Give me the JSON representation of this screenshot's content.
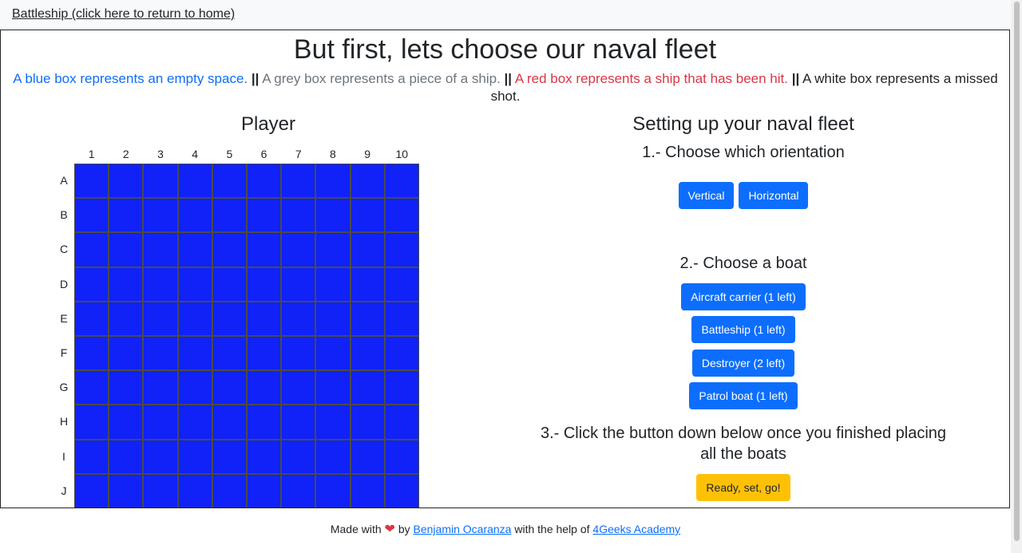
{
  "nav": {
    "home_link": "Battleship (click here to return to home)"
  },
  "main": {
    "title": "But first, lets choose our naval fleet",
    "legend": {
      "blue": "A blue box represents an empty space.",
      "grey": "A grey box represents a piece of a ship.",
      "red": "A red box represents a ship that has been hit.",
      "white": "A white box represents a missed shot.",
      "separator": "||"
    }
  },
  "board": {
    "title": "Player",
    "columns": [
      "1",
      "2",
      "3",
      "4",
      "5",
      "6",
      "7",
      "8",
      "9",
      "10"
    ],
    "rows": [
      "A",
      "B",
      "C",
      "D",
      "E",
      "F",
      "G",
      "H",
      "I",
      "J"
    ],
    "empty_color": "#1022f7"
  },
  "setup": {
    "title": "Setting up your naval fleet",
    "step1": "1.- Choose which orientation",
    "orientation_buttons": [
      "Vertical",
      "Horizontal"
    ],
    "step2": "2.- Choose a boat",
    "boat_buttons": [
      "Aircraft carrier (1 left)",
      "Battleship (1 left)",
      "Destroyer (2 left)",
      "Patrol boat (1 left)"
    ],
    "step3_line1": "3.- Click the button down below once you finished placing",
    "step3_line2": "all the boats",
    "ready_button": "Ready, set, go!"
  },
  "footer": {
    "made_with": "Made with",
    "heart_icon": "heart-icon",
    "by": "by",
    "author": "Benjamin Ocaranza",
    "help": "with the help of",
    "academy": "4Geeks Academy"
  },
  "colors": {
    "primary": "#0d6efd",
    "warning": "#ffc107",
    "danger": "#dc3545",
    "secondary": "#6c757d"
  }
}
